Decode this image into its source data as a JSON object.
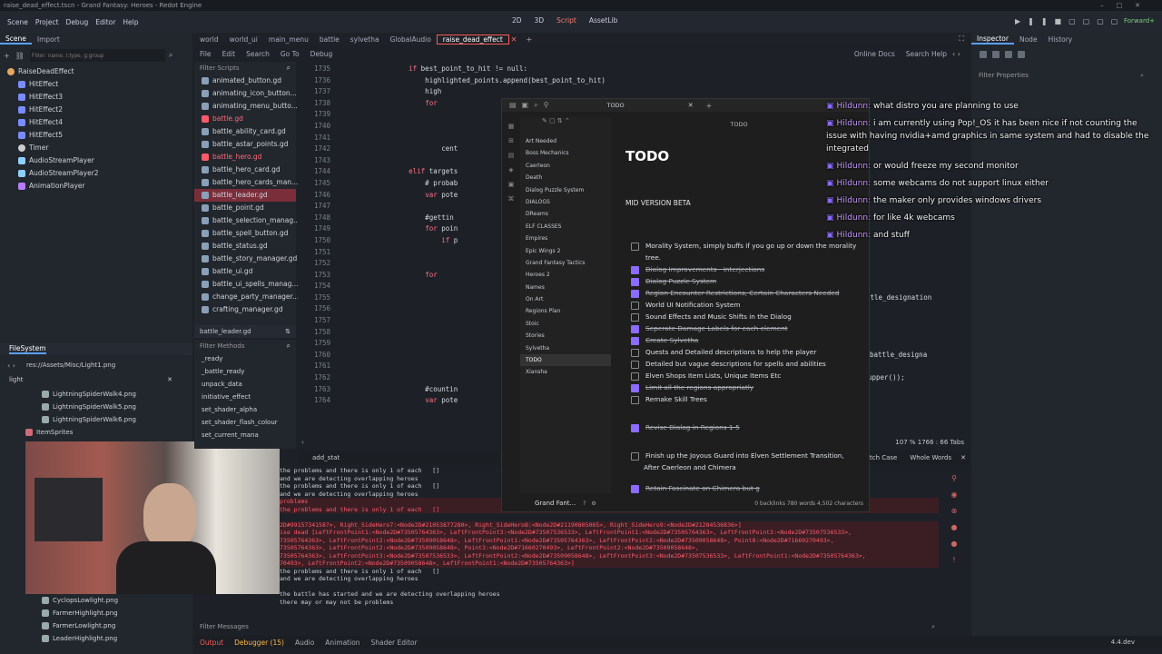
{
  "window_title": "raise_dead_effect.tscn - Grand Fantasy: Heroes - Redot Engine",
  "menu": [
    "Scene",
    "Project",
    "Debug",
    "Editor",
    "Help"
  ],
  "modes": [
    "2D",
    "3D",
    "Script",
    "AssetLib"
  ],
  "scene_dock": {
    "tabs": [
      "Scene",
      "Import"
    ],
    "filter_placeholder": "Filter: name, t:type, g:group",
    "nodes": [
      "RaiseDeadEffect",
      "HitEffect",
      "HitEffect3",
      "HitEffect2",
      "HitEffect4",
      "HitEffect5",
      "Timer",
      "AudioStreamPlayer",
      "AudioStreamPlayer2",
      "AnimationPlayer"
    ]
  },
  "filesystem": {
    "title": "FileSystem",
    "path": "res://Assets/Misc/Light1.png",
    "search": "light",
    "files": [
      "LightningSpiderWalk4.png",
      "LightningSpiderWalk5.png",
      "LightningSpiderWalk6.png"
    ],
    "folder": "ItemSprites",
    "files_bottom": [
      "CyclopsLowlight.png",
      "FarmerHighlight.png",
      "FarmerLowlight.png",
      "LeaderHighlight.png"
    ]
  },
  "editor_tabs": [
    "world",
    "world_ui",
    "main_menu",
    "battle",
    "sylvetha",
    "GlobalAudio",
    "raise_dead_effect"
  ],
  "script_menu": [
    "File",
    "Edit",
    "Search",
    "Go To",
    "Debug"
  ],
  "script_right": [
    "Online Docs",
    "Search Help"
  ],
  "script_list": {
    "filter_placeholder": "Filter Scripts",
    "items": [
      "animated_button.gd",
      "animating_icon_button...",
      "animating_menu_butto...",
      "battle.gd",
      "battle_ability_card.gd",
      "battle_astar_points.gd",
      "battle_hero.gd",
      "battle_hero_card.gd",
      "battle_hero_cards_man...",
      "battle_leader.gd",
      "battle_point.gd",
      "battle_selection_manag...",
      "battle_spell_button.gd",
      "battle_status.gd",
      "battle_story_manager.gd",
      "battle_ui.gd",
      "battle_ui_spells_manag...",
      "change_party_manager...",
      "crafting_manager.gd"
    ],
    "current": "battle_leader.gd",
    "methods_placeholder": "Filter Methods",
    "methods": [
      "_ready",
      "_battle_ready",
      "unpack_data",
      "initiative_effect",
      "set_shader_alpha",
      "set_shader_flash_colour",
      "set_current_mana"
    ]
  },
  "code": {
    "lines": [
      {
        "n": "1735",
        "t": "        if best_point_to_hit != null:"
      },
      {
        "n": "1736",
        "t": "            highlighted_points.append(best_point_to_hit)"
      },
      {
        "n": "1737",
        "t": "            high"
      },
      {
        "n": "1738",
        "t": "            for"
      },
      {
        "n": "1739",
        "t": ""
      },
      {
        "n": "1740",
        "t": ""
      },
      {
        "n": "1741",
        "t": ""
      },
      {
        "n": "1742",
        "t": "                cent"
      },
      {
        "n": "1743",
        "t": ""
      },
      {
        "n": "1744",
        "t": "        elif targets"
      },
      {
        "n": "1745",
        "t": "            # probab"
      },
      {
        "n": "1746",
        "t": "            var pote"
      },
      {
        "n": "1747",
        "t": ""
      },
      {
        "n": "1748",
        "t": "            #gettin"
      },
      {
        "n": "1749",
        "t": "            for poin"
      },
      {
        "n": "1750",
        "t": "                if p"
      },
      {
        "n": "1751",
        "t": ""
      },
      {
        "n": "1752",
        "t": ""
      },
      {
        "n": "1753",
        "t": "            for"
      },
      {
        "n": "1754",
        "t": ""
      },
      {
        "n": "1755",
        "t": ""
      },
      {
        "n": "1756",
        "t": ""
      },
      {
        "n": "1757",
        "t": ""
      },
      {
        "n": "1758",
        "t": ""
      },
      {
        "n": "1759",
        "t": ""
      },
      {
        "n": "1760",
        "t": ""
      },
      {
        "n": "1761",
        "t": ""
      },
      {
        "n": "1762",
        "t": ""
      },
      {
        "n": "1763",
        "t": "            #countin"
      },
      {
        "n": "1764",
        "t": "            var pote"
      }
    ],
    "side_text": [
      "ttle_designation",
      "battle_designa",
      "upper());"
    ],
    "status": "107 %   1766 :  66   Tabs",
    "find_value": "add_stat",
    "find_options": [
      "Match Case",
      "Whole Words"
    ]
  },
  "output": {
    "lines": [
      {
        "t": "the problems and there is only 1 of each   []",
        "e": false
      },
      {
        "t": "and we are detecting overlapping heroes",
        "e": false
      },
      {
        "t": "the problems and there is only 1 of each   []",
        "e": false
      },
      {
        "t": "and we are detecting overlapping heroes",
        "e": false
      },
      {
        "t": "problems",
        "e": true
      },
      {
        "t": "the problems and there is only 1 of each   []",
        "e": true
      },
      {
        "t": "",
        "e": false
      },
      {
        "t": "2D#9915734158?>, Right_SideHero7:<Node2D#21053877280>, Right_SideHero8:<Node2D#21190805065>, Right_SideHero9:<Node2D#21284536836>]",
        "e": true
      },
      {
        "t": "ise dead [LeftFrontPoint1:<Node2D#73505764363>, LeftFrontPoint3:<Node2D#73507536533>, LeftFrontPoint1:<Node2D#73505764363>, LeftFrontPoint3:<Node2D#73507536533>,",
        "e": true
      },
      {
        "t": "73505764363>, LeftFrontPoint2:<Node2D#73509058648>, LeftFrontPoint1:<Node2D#73505764363>, LeftFrontPoint2:<Node2D#73509058648>, Point8:<Node2D#71660270493>,",
        "e": true
      },
      {
        "t": "73505764363>, LeftFrontPoint2:<Node2D#73509058648>, Point3:<Node2D#71660270493>, LeftFrontPoint2:<Node2D#73509058648>,",
        "e": true
      },
      {
        "t": "73505764363>, LeftFrontPoint3:<Node2D#73507536533>, LeftFrontPoint2:<Node2D#73509058648>, LeftFrontPoint3:<Node2D#73507536533>, LeftFrontPoint1:<Node2D#73505764363>,",
        "e": true
      },
      {
        "t": "70493>, LeftFrontPoint2:<Node2D#73509058648>, LeftFrontPoint1:<Node2D#73505764363>]",
        "e": true
      },
      {
        "t": "the problems and there is only 1 of each   []",
        "e": false
      },
      {
        "t": "and we are detecting overlapping heroes",
        "e": false
      },
      {
        "t": "",
        "e": false
      },
      {
        "t": "the battle has started and we are detecting overlapping heroes",
        "e": false
      },
      {
        "t": "there may or may not be problems",
        "e": false
      }
    ],
    "filter_placeholder": "Filter Messages"
  },
  "bottom_tabs": [
    "Output",
    "Debugger (15)",
    "Audio",
    "Animation",
    "Shader Editor"
  ],
  "version": "4.4.dev",
  "inspector": {
    "tabs": [
      "Inspector",
      "Node",
      "History"
    ],
    "filter_placeholder": "Filter Properties"
  },
  "chat": [
    {
      "name": "Hildunn",
      "msg": "what distro you are planning to use"
    },
    {
      "name": "Hildunn",
      "msg": "i am currently using Pop!_OS it has been nice if not counting the issue with having nvidia+amd graphics in same system and had to disable the integrated"
    },
    {
      "name": "Hildunn",
      "msg": "or would freeze my second monitor"
    },
    {
      "name": "Hildunn",
      "msg": "some webcams do not support linux either"
    },
    {
      "name": "Hildunn",
      "msg": "the maker only provides windows drivers"
    },
    {
      "name": "Hildunn",
      "msg": "for like 4k webcams"
    },
    {
      "name": "Hildunn",
      "msg": "and stuff"
    }
  ],
  "notes": {
    "tab_title": "TODO",
    "header_small": "TODO",
    "vault": "Grand Fant...",
    "footer": "0 backlinks   780 words  4,502 characters",
    "folders": [
      "Art Needed",
      "Boss Mechanics",
      "Caerleon",
      "Death",
      "Dialog Puzzle System",
      "DIALOGS",
      "DReams",
      "ELF CLASSES",
      "Empires",
      "Epic Wings 2",
      "Grand Fantasy Tactics",
      "Heroes 2",
      "Names",
      "On Art",
      "Regions Plan",
      "Stoic",
      "Stories",
      "Sylvetha",
      "TODO",
      "Xiansha"
    ],
    "title": "TODO",
    "section": "MID VERSION BETA",
    "items": [
      {
        "t": "Morality System, simply buffs if you go up or down the morality",
        "c": false
      },
      {
        "t": "tree.",
        "c": false,
        "cont": true
      },
      {
        "t": "Dialog Improvements - Interjections",
        "c": true
      },
      {
        "t": "Dialog Puzzle System",
        "c": true
      },
      {
        "t": "Region Encounter Restrictions, Certain Characters Needed",
        "c": true
      },
      {
        "t": "World UI Notification System",
        "c": false
      },
      {
        "t": "Sound Effects and Music Shifts in the Dialog",
        "c": false
      },
      {
        "t": "Seperate Damage Labels for each element",
        "c": true
      },
      {
        "t": "Create Sylvetha",
        "c": true
      },
      {
        "t": "Quests and Detailed descriptions to help the player",
        "c": false
      },
      {
        "t": "Detailed but vague descriptions for spells and abilities",
        "c": false
      },
      {
        "t": "Elven Shops Item Lists, Unique Items Etc",
        "c": false
      },
      {
        "t": "Limit all the regions appropriatly",
        "c": true
      },
      {
        "t": "Remake Skill Trees",
        "c": false
      }
    ],
    "item_revise": "Revise Dialog in Regions 1-5",
    "item_finish_1": "Finish up the Joyous Guard into Elven Settlement Transition,",
    "item_finish_2": "After Caerleon and Chimera",
    "item_retain": "Retain Fascinate on Chimera but g"
  },
  "colors": {
    "accent": "#5aa0ff",
    "script_red": "#ff7a6b",
    "todo_check": "#8b6cff",
    "chat_name": "#c69bff"
  }
}
